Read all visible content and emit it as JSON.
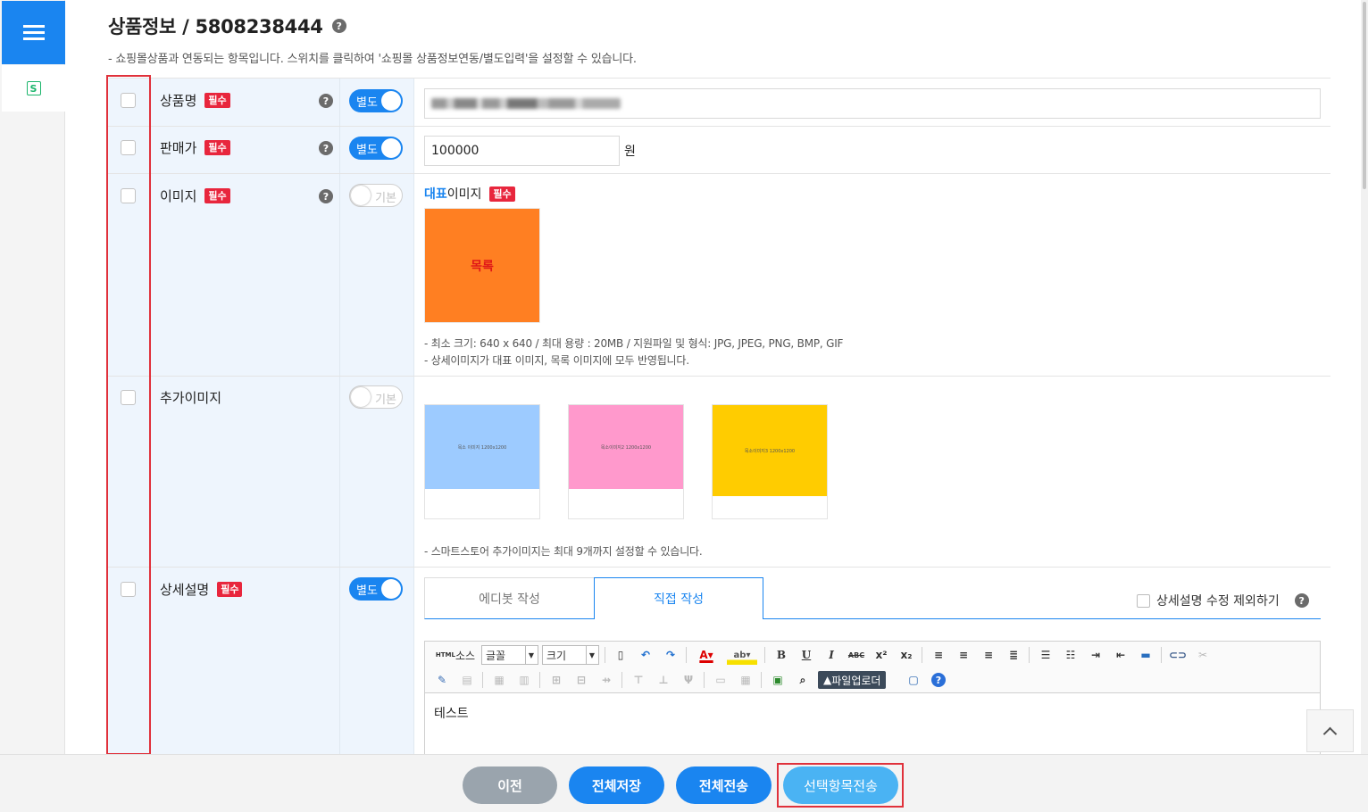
{
  "header": {
    "title": "상품정보 / 5808238444",
    "subtitle": "- 쇼핑몰상품과 연동되는 항목입니다. 스위치를 클릭하여 '쇼핑몰 상품정보연동/별도입력'을 설정할 수 있습니다."
  },
  "rows": {
    "name": {
      "label": "상품명",
      "required": "필수",
      "toggle": "별도"
    },
    "price": {
      "label": "판매가",
      "required": "필수",
      "toggle": "별도",
      "value": "100000",
      "unit": "원"
    },
    "image": {
      "label": "이미지",
      "required": "필수",
      "toggle": "기본",
      "rep_label_prefix": "대표",
      "rep_label_suffix": "이미지",
      "rep_required": "필수",
      "rep_thumb_text": "목록",
      "note1": "- 최소 크기: 640 x 640 / 최대 용량 : 20MB / 지원파일 및 형식: JPG, JPEG, PNG, BMP, GIF",
      "note2": "- 상세이미지가 대표 이미지, 목록 이미지에 모두 반영됩니다."
    },
    "extra_images": {
      "label": "추가이미지",
      "toggle": "기본",
      "images": [
        {
          "text": "목소 이미지 1200x1200",
          "color": "#9dcbff"
        },
        {
          "text": "목소이미지2 1200x1200",
          "color": "#ff99cc"
        },
        {
          "text": "목소이미지3 1200x1200",
          "color": "#ffcc00"
        }
      ],
      "note": "- 스마트스토어 추가이미지는 최대 9개까지 설정할 수 있습니다."
    },
    "description": {
      "label": "상세설명",
      "required": "필수",
      "toggle": "별도",
      "tab_editor": "에디봇 작성",
      "tab_direct": "직접 작성",
      "exclude_label": "상세설명 수정 제외하기",
      "toolbar": {
        "html": "HTML",
        "source": "소스",
        "font": "글꼴",
        "size": "크기",
        "file_uploader": "파일업로더"
      },
      "body": "테스트"
    }
  },
  "footer": {
    "prev": "이전",
    "save_all": "전체저장",
    "send_all": "전체전송",
    "send_selected": "선택항목전송"
  },
  "colors": {
    "accent": "#1a85f0",
    "required_badge": "#e8263d",
    "highlight_frame": "#e0313b"
  },
  "icons": [
    "menu-icon",
    "smartstore-icon",
    "help-icon",
    "scroll-top-icon"
  ]
}
